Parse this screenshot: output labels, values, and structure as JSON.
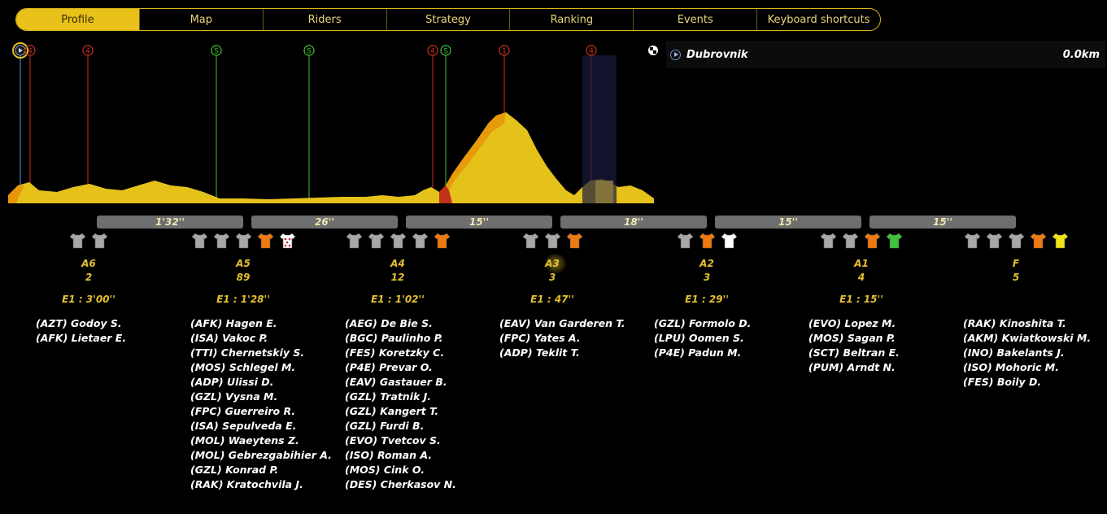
{
  "tabs": [
    "Profile",
    "Map",
    "Riders",
    "Strategy",
    "Ranking",
    "Events",
    "Keyboard shortcuts"
  ],
  "active_tab": "Profile",
  "location": {
    "name": "Dubrovnik",
    "distance": "0.0km"
  },
  "markers": [
    {
      "symbol": "4",
      "kind": "climb-cat4"
    },
    {
      "symbol": "S",
      "kind": "sprint"
    },
    {
      "symbol": "S",
      "kind": "sprint"
    },
    {
      "symbol": "4",
      "kind": "climb-cat4"
    },
    {
      "symbol": "S",
      "kind": "sprint"
    },
    {
      "symbol": "1",
      "kind": "climb-cat1"
    },
    {
      "symbol": "4",
      "kind": "climb-cat4"
    }
  ],
  "gaps": [
    "1'32''",
    "26''",
    "15''",
    "18''",
    "15''",
    "15''"
  ],
  "groups": [
    {
      "label": "A6",
      "count": "2",
      "time": "E1 : 3'00''",
      "jerseys": [
        "grey",
        "grey"
      ],
      "riders": [
        "(AZT) Godoy S.",
        "(AFK) Lietaer E."
      ]
    },
    {
      "label": "A5",
      "count": "89",
      "time": "E1 : 1'28''",
      "jerseys": [
        "grey",
        "grey",
        "grey",
        "orange",
        "polka"
      ],
      "riders": [
        "(AFK) Hagen E.",
        "(ISA) Vakoc P.",
        "(TTI) Chernetskiy S.",
        "(MOS) Schlegel M.",
        "(ADP) Ulissi D.",
        "(GZL) Vysna M.",
        "(FPC) Guerreiro R.",
        "(ISA) Sepulveda E.",
        "(MOL) Waeytens Z.",
        "(MOL) Gebrezgabihier A.",
        "(GZL) Konrad P.",
        "(RAK) Kratochvila J."
      ]
    },
    {
      "label": "A4",
      "count": "12",
      "time": "E1 : 1'02''",
      "jerseys": [
        "grey",
        "grey",
        "grey",
        "grey",
        "orange"
      ],
      "riders": [
        "(AEG) De Bie S.",
        "(BGC) Paulinho P.",
        "(FES) Koretzky C.",
        "(P4E) Prevar O.",
        "(EAV) Gastauer B.",
        "(GZL) Tratnik J.",
        "(GZL) Kangert T.",
        "(GZL) Furdi B.",
        "(EVO) Tvetcov S.",
        "(ISO) Roman A.",
        "(MOS) Cink O.",
        "(DES) Cherkasov N."
      ]
    },
    {
      "label": "A3",
      "count": "3",
      "time": "E1 : 47''",
      "jerseys": [
        "grey",
        "grey",
        "orange"
      ],
      "riders": [
        "(EAV) Van Garderen T.",
        "(FPC) Yates A.",
        "(ADP) Teklit T."
      ]
    },
    {
      "label": "A2",
      "count": "3",
      "time": "E1 : 29''",
      "jerseys": [
        "grey",
        "orange",
        "white"
      ],
      "riders": [
        "(GZL) Formolo D.",
        "(LPU) Oomen S.",
        "(P4E) Padun M."
      ]
    },
    {
      "label": "A1",
      "count": "4",
      "time": "E1 : 15''",
      "jerseys": [
        "grey",
        "grey",
        "orange",
        "green"
      ],
      "riders": [
        "(EVO) Lopez M.",
        "(MOS) Sagan P.",
        "(SCT) Beltran E.",
        "(PUM) Arndt N."
      ]
    },
    {
      "label": "F",
      "count": "5",
      "time": "",
      "jerseys": [
        "grey",
        "grey",
        "grey",
        "orange",
        "yellow"
      ],
      "riders": [
        "(RAK) Kinoshita T.",
        "(AKM) Kwiatkowski M.",
        "(INO) Bakelants J.",
        "(ISO) Mohoric M.",
        "(FES) Boily D."
      ]
    }
  ],
  "colors": {
    "accent": "#e8c21a",
    "profile_fill": "#e5c21a",
    "climb_orange": "#e8960a",
    "climb_red": "#c0301a",
    "jersey_grey": "#a8a8a8",
    "jersey_orange": "#f07a10",
    "jersey_green": "#3ec43a",
    "jersey_yellow": "#f2e21a",
    "jersey_white": "#ffffff"
  }
}
